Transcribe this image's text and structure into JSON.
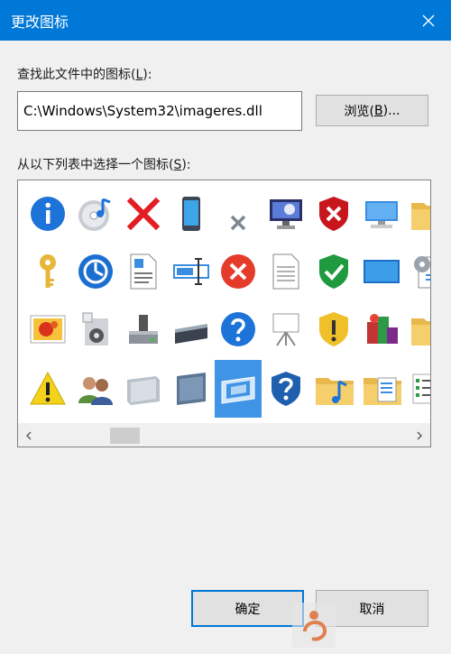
{
  "window": {
    "title": "更改图标",
    "close_icon": "close-icon"
  },
  "find_label": {
    "text": "查找此文件中的图标(",
    "accel": "L",
    "suffix": "):"
  },
  "path_input": {
    "value": "C:\\Windows\\System32\\imageres.dll"
  },
  "browse_button": {
    "text": "浏览(",
    "accel": "B",
    "suffix": ")..."
  },
  "list_label": {
    "text": "从以下列表中选择一个图标(",
    "accel": "S",
    "suffix": "):"
  },
  "icon_grid": {
    "rows": [
      [
        "info-icon",
        "media-cd-icon",
        "red-x-icon",
        "mobile-device-icon",
        "small-x-icon",
        "monitor-icon",
        "shield-error-icon",
        "computer-icon",
        "folder-icon"
      ],
      [
        "key-icon",
        "performance-clock-icon",
        "document-icon",
        "rename-icon",
        "error-icon",
        "blank-page-icon",
        "shield-check-icon",
        "screen-icon",
        "settings-document-icon"
      ],
      [
        "pictures-icon",
        "media-player-icon",
        "drive-icon",
        "scanner-icon",
        "help-icon",
        "projector-icon",
        "shield-warning-icon",
        "programs-icon",
        "folder-icon"
      ],
      [
        "warning-icon",
        "users-icon",
        "server-icon",
        "panel-icon",
        "display-selected-icon",
        "shield-help-icon",
        "music-folder-icon",
        "documents-folder-icon",
        "list-icon"
      ]
    ],
    "selected": "display-selected-icon"
  },
  "scrollbar": {
    "left_icon": "chevron-left-icon",
    "right_icon": "chevron-right-icon"
  },
  "ok_button": {
    "text": "确定"
  },
  "cancel_button": {
    "text": "取消"
  },
  "colors": {
    "titlebar": "#0078d7",
    "selection": "#3f94e6",
    "background": "#f0f0f0"
  }
}
